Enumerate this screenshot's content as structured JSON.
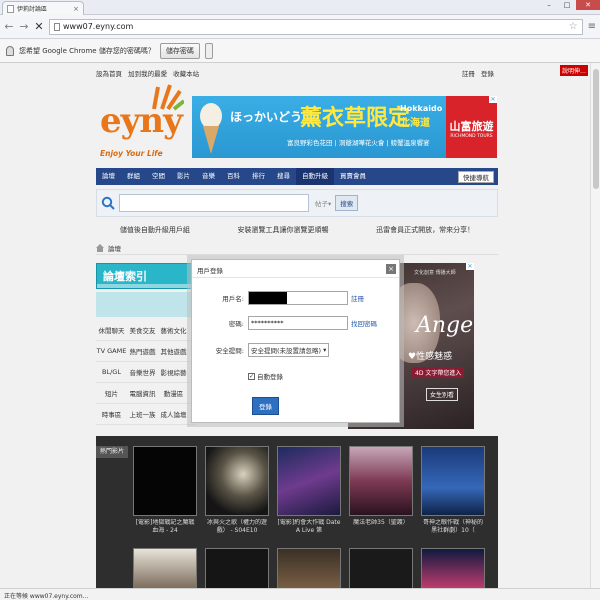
{
  "browser": {
    "tab_title": "伊莉討論區",
    "tab_close": "×",
    "window_buttons": {
      "minimize": "–",
      "maximize": "□",
      "close": "✕"
    },
    "url": "www07.eyny.com",
    "infobar": {
      "message": "您希望 Google Chrome 儲存您的密碼嗎？",
      "save_button": "儲存密碼"
    },
    "status_text": "正在等候 www07.eyny.com..."
  },
  "site": {
    "side_link": "說明伸…",
    "top_links_left": [
      "設為首頁",
      "加到我的最愛",
      "收藏本站"
    ],
    "top_links_right": [
      "註冊",
      "登錄"
    ],
    "logo": {
      "name": "eyny",
      "tagline": "Enjoy Your Life"
    },
    "banner": {
      "jp_text": "ほっかいどう",
      "headline": "薰衣草限定",
      "place_en": "Hokkaido",
      "place_zh": "北海道",
      "sub": "富良野彩色花田 | 洞爺湖嘩花火會 | 螃蟹溫泉饗宴",
      "brand": "山富旅遊",
      "brand_en": "RICHMOND TOURS",
      "ad_marker": "✕"
    },
    "nav": [
      "論壇",
      "群組",
      "空間",
      "影片",
      "音樂",
      "百科",
      "排行",
      "搜尋",
      "自動升級",
      "買賣會員"
    ],
    "nav_active": "自動升級",
    "quick_nav": "快捷導航",
    "search": {
      "placeholder": "",
      "type_label": "帖子▾",
      "button": "搜索"
    },
    "notices": [
      "儲值後自動升級用戶組",
      "安裝瀏覽工具讓你瀏覽更順暢",
      "迅雷會員正式開放，常來分享！"
    ],
    "breadcrumb": "論壇",
    "category_title": "論壇索引",
    "categories": [
      [
        "休閒聊天",
        "美食交友",
        "藝術文化"
      ],
      [
        "TV GAME",
        "熱門遊戲",
        "其他遊戲"
      ],
      [
        "BL/GL",
        "音樂世界",
        "影視綜藝"
      ],
      [
        "短片",
        "電腦資訊",
        "動漫區"
      ],
      [
        "時事區",
        "上班一族",
        "成人論壇"
      ]
    ],
    "side_ad": {
      "top": "文化創意 傳播大師",
      "title": "Angel",
      "line2": "♥性感魅惑",
      "line3": "4D 文字帶您進入",
      "button": "女生別看",
      "ad_marker": "✕"
    },
    "popular_label": "熱門影片",
    "videos": [
      {
        "caption": "[電影]地獄戰記之魔戰血海 - 24"
      },
      {
        "caption": "冰與火之歌（權力的遊戲） - S04E10"
      },
      {
        "caption": "[電影]約會大作戰 Date A Live 第"
      },
      {
        "caption": "魔法老師35（聖護）"
      },
      {
        "caption": "哥神之眼作戰（神秘的黑社群劇）10（"
      }
    ]
  },
  "login_modal": {
    "title": "用戶登錄",
    "close": "×",
    "username_label": "用戶名:",
    "username_value": "",
    "register_link": "註冊",
    "password_label": "密碼:",
    "password_value": "**********",
    "forgot_link": "找回密碼",
    "security_label": "安全提問:",
    "security_value": "安全提問(未設置請忽略)",
    "remember_label": "自動登錄",
    "login_button": "登錄"
  },
  "colors": {
    "nav_blue": "#26488a",
    "logo_orange": "#e8771c",
    "login_button": "#2d6fc0"
  }
}
